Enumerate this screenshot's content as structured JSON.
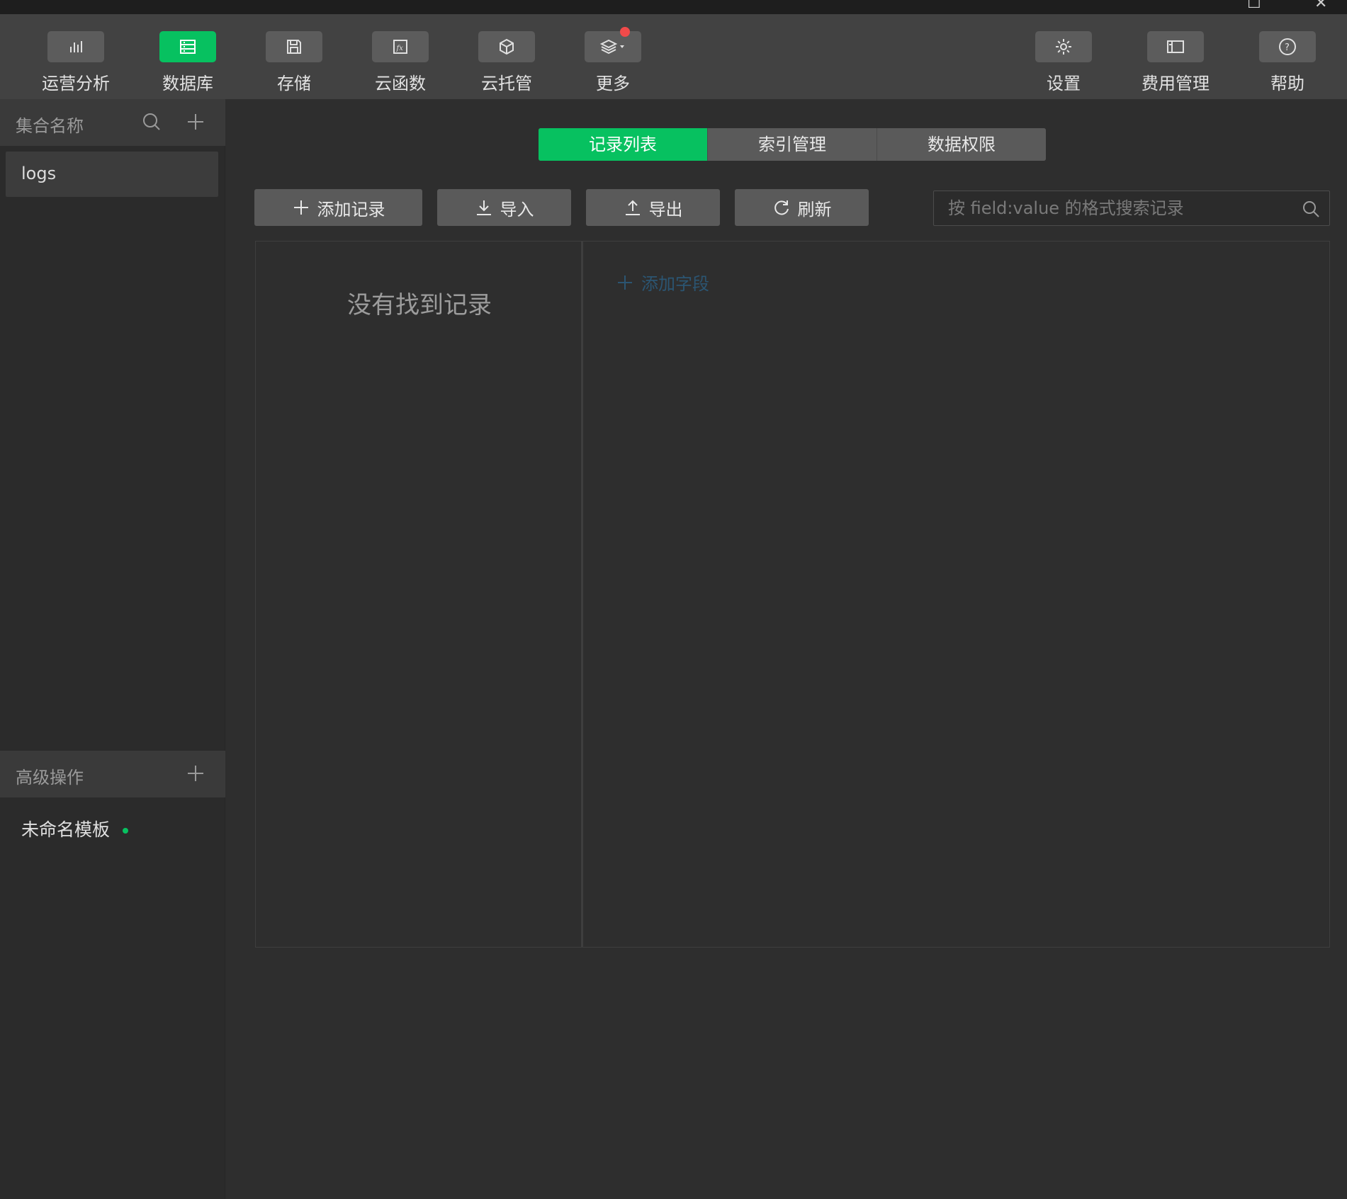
{
  "toolbar": {
    "left_items": [
      {
        "label": "运营分析",
        "icon": "bar-chart-icon"
      },
      {
        "label": "数据库",
        "icon": "database-icon",
        "active": true
      },
      {
        "label": "存储",
        "icon": "floppy-icon"
      },
      {
        "label": "云函数",
        "icon": "function-icon"
      },
      {
        "label": "云托管",
        "icon": "box-icon"
      },
      {
        "label": "更多",
        "icon": "layers-icon",
        "badge": true
      }
    ],
    "right_items": [
      {
        "label": "设置",
        "icon": "gear-icon"
      },
      {
        "label": "费用管理",
        "icon": "billing-icon"
      },
      {
        "label": "帮助",
        "icon": "help-icon"
      }
    ]
  },
  "sidebar": {
    "collections_header": "集合名称",
    "collections": [
      "logs"
    ],
    "advanced_header": "高级操作",
    "templates": [
      "未命名模板"
    ]
  },
  "tabs": [
    {
      "label": "记录列表",
      "active": true
    },
    {
      "label": "索引管理"
    },
    {
      "label": "数据权限"
    }
  ],
  "actions": {
    "add_record": "添加记录",
    "import": "导入",
    "export": "导出",
    "refresh": "刷新"
  },
  "search": {
    "placeholder": "按 field:value 的格式搜索记录"
  },
  "records": {
    "empty_message": "没有找到记录",
    "add_field": "添加字段"
  },
  "colors": {
    "accent": "#07c160",
    "badge": "#f04a4a"
  }
}
